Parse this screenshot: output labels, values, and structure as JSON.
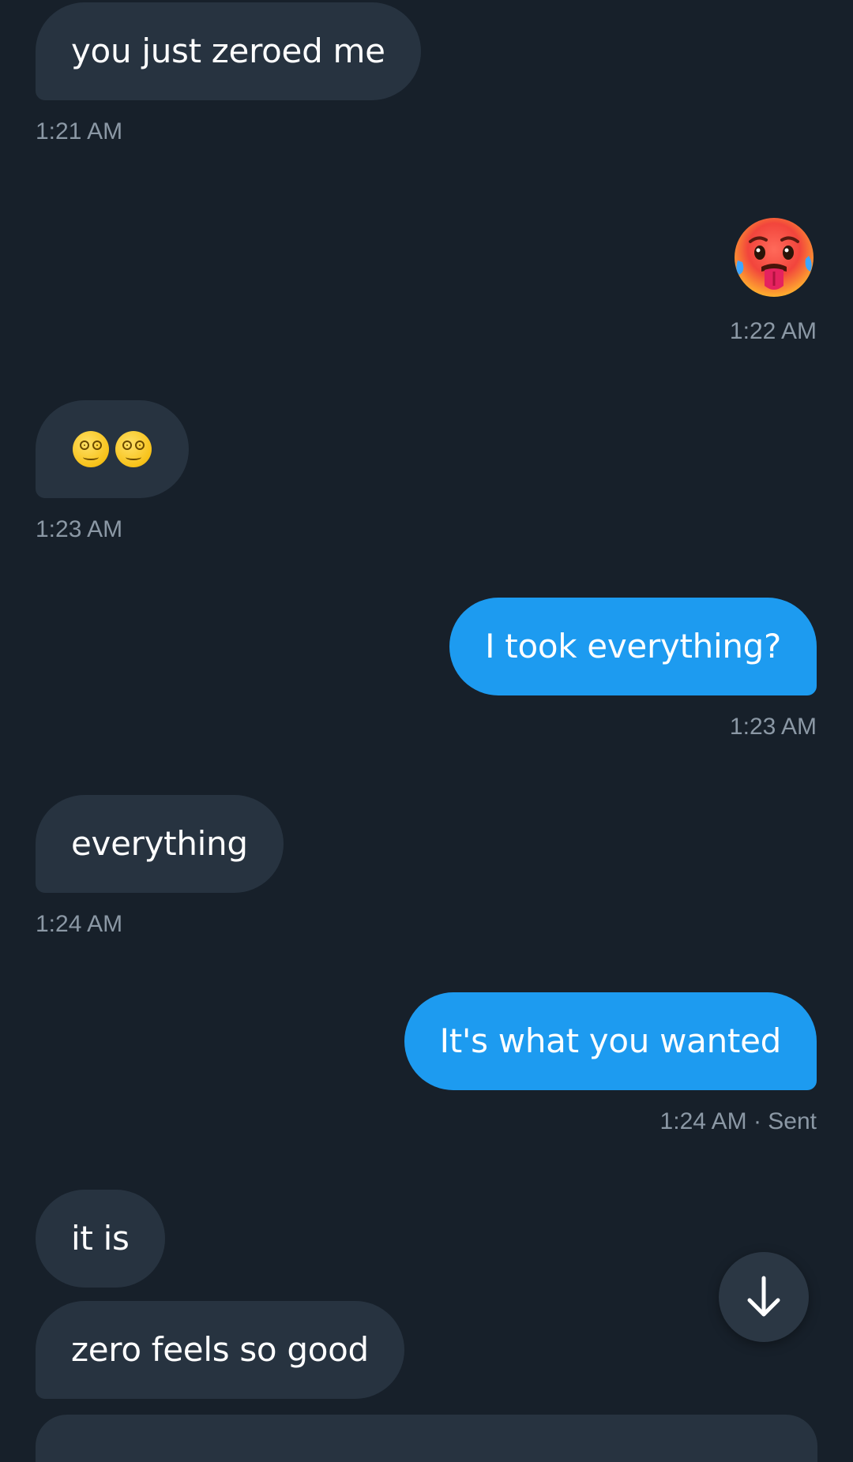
{
  "messages": [
    {
      "id": "m1",
      "direction": "in",
      "text": "you just zeroed me",
      "time": "1:21 AM"
    },
    {
      "id": "m2",
      "direction": "out",
      "emoji": "hot-face",
      "time": "1:22 AM"
    },
    {
      "id": "m3",
      "direction": "in",
      "emoji": "face-with-spiral-eyes x2",
      "time": "1:23 AM"
    },
    {
      "id": "m4",
      "direction": "out",
      "text": "I took everything?",
      "time": "1:23 AM"
    },
    {
      "id": "m5",
      "direction": "in",
      "text": "everything",
      "time": "1:24 AM"
    },
    {
      "id": "m6",
      "direction": "out",
      "text": "It's what you wanted",
      "time": "1:24 AM · Sent"
    },
    {
      "id": "m7",
      "direction": "in",
      "text": "it is"
    },
    {
      "id": "m8",
      "direction": "in",
      "text": "zero feels so good"
    }
  ],
  "scroll_button": {
    "icon": "arrow-down-icon"
  },
  "colors": {
    "background": "#17202a",
    "incoming_bubble": "#273340",
    "outgoing_bubble": "#1d9bf0",
    "timestamp": "#8b98a5"
  }
}
